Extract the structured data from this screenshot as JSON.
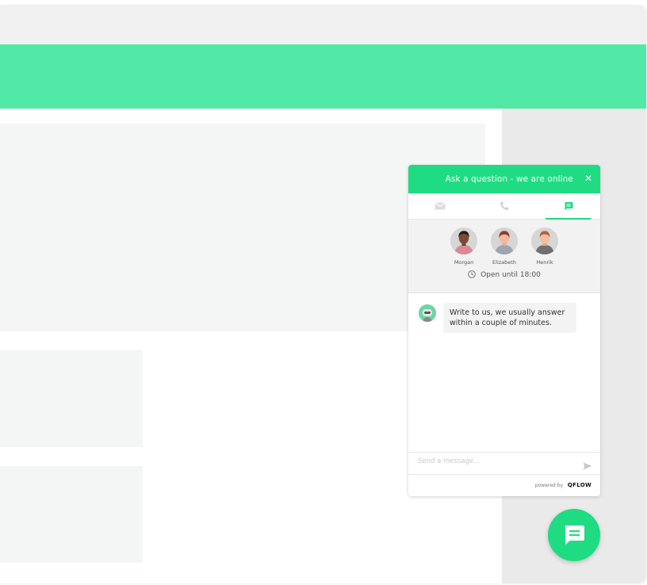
{
  "widget": {
    "header_title": "Ask a question - we are online",
    "close_glyph": "✕",
    "tabs": [
      {
        "name": "email",
        "icon": "envelope-icon",
        "active": false
      },
      {
        "name": "phone",
        "icon": "phone-icon",
        "active": false
      },
      {
        "name": "chat",
        "icon": "chat-icon",
        "active": true
      }
    ],
    "agents": [
      {
        "name": "Morgan"
      },
      {
        "name": "Elizabeth"
      },
      {
        "name": "Henrik"
      }
    ],
    "hours": "Open until 18:00",
    "greeting": "Write to us, we usually answer within a couple of minutes.",
    "input_placeholder": "Send a message...",
    "powered_by": "powered by",
    "brand": "QFLOW"
  },
  "colors": {
    "accent": "#1fdc82",
    "hero": "#52e9a6"
  }
}
